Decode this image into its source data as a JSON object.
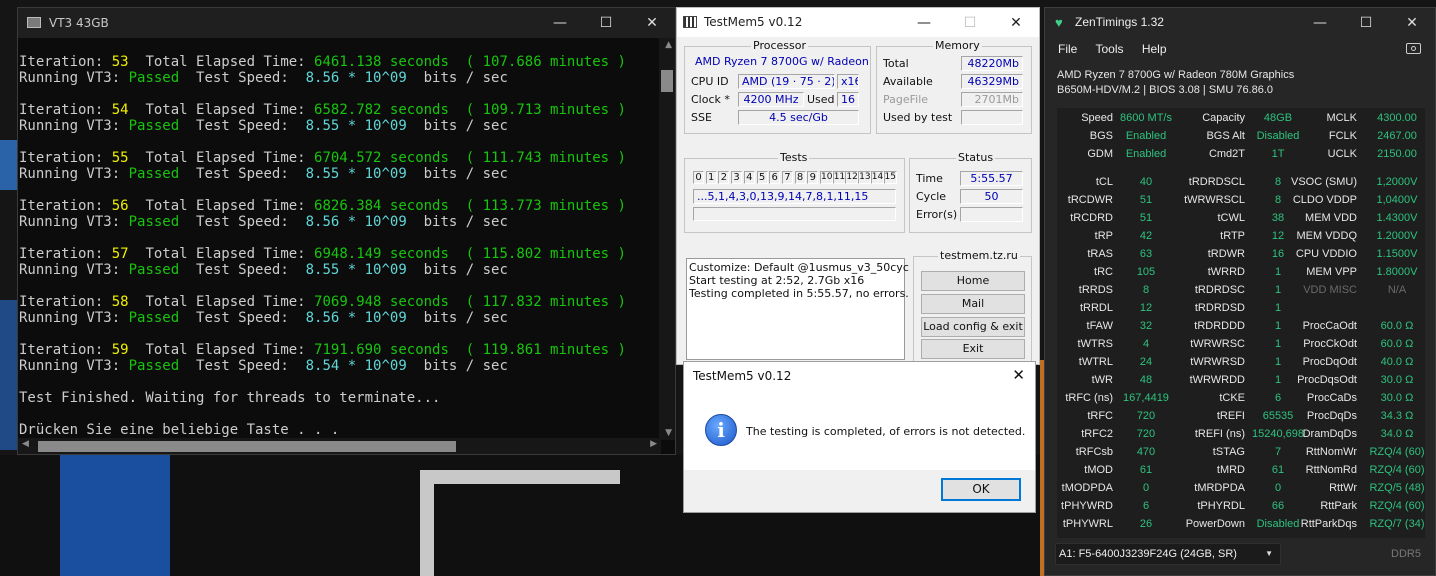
{
  "terminal": {
    "title": "VT3 43GB",
    "blocks": [
      {
        "iter": "53",
        "elapsed": "6461.138 seconds",
        "minutes": "( 107.686 minutes )",
        "status": "Passed",
        "speed": "8.56 * 10^09"
      },
      {
        "iter": "54",
        "elapsed": "6582.782 seconds",
        "minutes": "( 109.713 minutes )",
        "status": "Passed",
        "speed": "8.55 * 10^09"
      },
      {
        "iter": "55",
        "elapsed": "6704.572 seconds",
        "minutes": "( 111.743 minutes )",
        "status": "Passed",
        "speed": "8.55 * 10^09"
      },
      {
        "iter": "56",
        "elapsed": "6826.384 seconds",
        "minutes": "( 113.773 minutes )",
        "status": "Passed",
        "speed": "8.56 * 10^09"
      },
      {
        "iter": "57",
        "elapsed": "6948.149 seconds",
        "minutes": "( 115.802 minutes )",
        "status": "Passed",
        "speed": "8.55 * 10^09"
      },
      {
        "iter": "58",
        "elapsed": "7069.948 seconds",
        "minutes": "( 117.832 minutes )",
        "status": "Passed",
        "speed": "8.56 * 10^09"
      },
      {
        "iter": "59",
        "elapsed": "7191.690 seconds",
        "minutes": "( 119.861 minutes )",
        "status": "Passed",
        "speed": "8.54 * 10^09"
      }
    ],
    "iteration_label": "Iteration:",
    "total_label": "Total Elapsed Time:",
    "running_label": "Running VT3:",
    "speed_label": "Test Speed:",
    "unit_label": "bits / sec",
    "finished": "Test Finished. Waiting for threads to terminate...",
    "press_key": "Drücken Sie eine beliebige Taste . . ."
  },
  "testmem": {
    "title": "TestMem5 v0.12",
    "processor_group": "Processor",
    "processor_name": "AMD Ryzen 7 8700G w/ Radeon",
    "cpu_id_label": "CPU ID",
    "cpu_id_value": "AMD  (19 · 75 · 2)",
    "cpu_threads": "x16",
    "clock_label": "Clock *",
    "clock_value": "4200 MHz",
    "used_label": "Used",
    "used_value": "16",
    "sse_label": "SSE",
    "sse_value": "4.5 sec/Gb",
    "memory_group": "Memory",
    "total_label": "Total",
    "total_value": "48220Mb",
    "available_label": "Available",
    "available_value": "46329Mb",
    "pagefile_label": "PageFile",
    "pagefile_value": "2701Mb",
    "usedbytest_label": "Used by test",
    "usedbytest_value": "",
    "tests_group": "Tests",
    "test_cells": [
      "0",
      "1",
      "2",
      "3",
      "4",
      "5",
      "6",
      "7",
      "8",
      "9",
      "10",
      "11",
      "12",
      "13",
      "14",
      "15"
    ],
    "test_sequence": "...5,1,4,3,0,13,9,14,7,8,1,11,15",
    "status_group": "Status",
    "time_label": "Time",
    "time_value": "5:55.57",
    "cycle_label": "Cycle",
    "cycle_value": "50",
    "errors_label": "Error(s)",
    "errors_value": "",
    "log": "Customize: Default @1usmus_v3_50cyc\nStart testing at 2:52, 2.7Gb x16\nTesting completed in 5:55.57, no errors.",
    "site_group": "testmem.tz.ru",
    "btn_home": "Home",
    "btn_mail": "Mail",
    "btn_load": "Load config & exit",
    "btn_exit": "Exit"
  },
  "dialog": {
    "title": "TestMem5 v0.12",
    "message": "The testing is completed, of errors is not detected.",
    "ok": "OK",
    "icon": "info-icon"
  },
  "zentimings": {
    "title": "ZenTimings 1.32",
    "menu": [
      "File",
      "Tools",
      "Help"
    ],
    "cpu_line": "AMD Ryzen 7 8700G w/ Radeon 780M Graphics",
    "board_line": "B650M-HDV/M.2 | BIOS 3.08 | SMU 76.86.0",
    "top": [
      [
        [
          "Speed",
          "8600 MT/s"
        ],
        [
          "Capacity",
          "48GB"
        ],
        [
          "MCLK",
          "4300.00"
        ]
      ],
      [
        [
          "BGS",
          "Enabled"
        ],
        [
          "BGS Alt",
          "Disabled"
        ],
        [
          "FCLK",
          "2467.00"
        ]
      ],
      [
        [
          "GDM",
          "Enabled"
        ],
        [
          "Cmd2T",
          "1T"
        ],
        [
          "UCLK",
          "2150.00"
        ]
      ]
    ],
    "rows": [
      [
        [
          "tCL",
          "40"
        ],
        [
          "tRDRDSCL",
          "8"
        ],
        [
          "VSOC (SMU)",
          "1,2000V"
        ]
      ],
      [
        [
          "tRCDWR",
          "51"
        ],
        [
          "tWRWRSCL",
          "8"
        ],
        [
          "CLDO VDDP",
          "1,0400V"
        ]
      ],
      [
        [
          "tRCDRD",
          "51"
        ],
        [
          "tCWL",
          "38"
        ],
        [
          "MEM VDD",
          "1.4300V"
        ]
      ],
      [
        [
          "tRP",
          "42"
        ],
        [
          "tRTP",
          "12"
        ],
        [
          "MEM VDDQ",
          "1.2000V"
        ]
      ],
      [
        [
          "tRAS",
          "63"
        ],
        [
          "tRDWR",
          "16"
        ],
        [
          "CPU VDDIO",
          "1.1500V"
        ]
      ],
      [
        [
          "tRC",
          "105"
        ],
        [
          "tWRRD",
          "1"
        ],
        [
          "MEM VPP",
          "1.8000V"
        ]
      ],
      [
        [
          "tRRDS",
          "8"
        ],
        [
          "tRDRDSC",
          "1"
        ],
        [
          "VDD MISC",
          "N/A"
        ]
      ],
      [
        [
          "tRRDL",
          "12"
        ],
        [
          "tRDRDSD",
          "1"
        ],
        [
          "",
          ""
        ]
      ],
      [
        [
          "tFAW",
          "32"
        ],
        [
          "tRDRDDD",
          "1"
        ],
        [
          "ProcCaOdt",
          "60.0 Ω"
        ]
      ],
      [
        [
          "tWTRS",
          "4"
        ],
        [
          "tWRWRSC",
          "1"
        ],
        [
          "ProcCkOdt",
          "60.0 Ω"
        ]
      ],
      [
        [
          "tWTRL",
          "24"
        ],
        [
          "tWRWRSD",
          "1"
        ],
        [
          "ProcDqOdt",
          "40.0 Ω"
        ]
      ],
      [
        [
          "tWR",
          "48"
        ],
        [
          "tWRWRDD",
          "1"
        ],
        [
          "ProcDqsOdt",
          "30.0 Ω"
        ]
      ],
      [
        [
          "tRFC (ns)",
          "167,4419"
        ],
        [
          "tCKE",
          "6"
        ],
        [
          "ProcCaDs",
          "30.0 Ω"
        ]
      ],
      [
        [
          "tRFC",
          "720"
        ],
        [
          "tREFI",
          "65535"
        ],
        [
          "ProcDqDs",
          "34.3 Ω"
        ]
      ],
      [
        [
          "tRFC2",
          "720"
        ],
        [
          "tREFI (ns)",
          "15240,698"
        ],
        [
          "DramDqDs",
          "34.0 Ω"
        ]
      ],
      [
        [
          "tRFCsb",
          "470"
        ],
        [
          "tSTAG",
          "7"
        ],
        [
          "RttNomWr",
          "RZQ/4 (60)"
        ]
      ],
      [
        [
          "tMOD",
          "61"
        ],
        [
          "tMRD",
          "61"
        ],
        [
          "RttNomRd",
          "RZQ/4 (60)"
        ]
      ],
      [
        [
          "tMODPDA",
          "0"
        ],
        [
          "tMRDPDA",
          "0"
        ],
        [
          "RttWr",
          "RZQ/5 (48)"
        ]
      ],
      [
        [
          "tPHYWRD",
          "6"
        ],
        [
          "tPHYRDL",
          "66"
        ],
        [
          "RttPark",
          "RZQ/4 (60)"
        ]
      ],
      [
        [
          "tPHYWRL",
          "26"
        ],
        [
          "PowerDown",
          "Disabled"
        ],
        [
          "RttParkDqs",
          "RZQ/7 (34)"
        ]
      ]
    ],
    "dimm": "A1: F5-6400J3239F24G (24GB, SR)",
    "ddr": "DDR5",
    "accent": "#2ec27e"
  }
}
